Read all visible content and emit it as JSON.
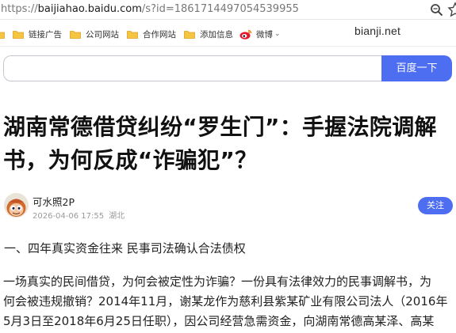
{
  "browser": {
    "url_prefix": "https://",
    "url_domain": "baijiahao.baidu.com",
    "url_path": "/s?id=1861714497054539955"
  },
  "bookmarks": [
    {
      "label": "链接广告"
    },
    {
      "label": "公司网站"
    },
    {
      "label": "合作网站"
    },
    {
      "label": "添加信息"
    },
    {
      "label": "微博"
    }
  ],
  "watermark": "bianji.net",
  "search": {
    "button_label": "百度一下",
    "query": ""
  },
  "article": {
    "title": "湖南常德借贷纠纷“罗生门”：手握法院调解书，为何反成“诈骗犯”？",
    "author": "可水照2P",
    "date": "2026-04-06 17:55",
    "location": "湖北",
    "follow_label": "关注",
    "section_heading": "一、四年真实资金往来 民事司法确认合法债权",
    "paragraph_lines": [
      "一场真实的民间借贷，为何会被定性为诈骗？一份具有法律效力的民事调解书，为",
      "何会被违规撤销？2014年11月，谢某龙作为慈利县紫某矿业有限公司法人（2016年",
      "5月3日至2018年6月25日任职），因公司经营急需资金，向湖南常德高某泽、高某"
    ]
  },
  "colors": {
    "accent": "#4e6ef2",
    "title": "#111111",
    "meta": "#9a9a9a"
  },
  "icons": {
    "zoom": "zoom-icon",
    "bookmark_star": "star-icon",
    "folder": "folder-icon",
    "weibo": "weibo-icon"
  }
}
